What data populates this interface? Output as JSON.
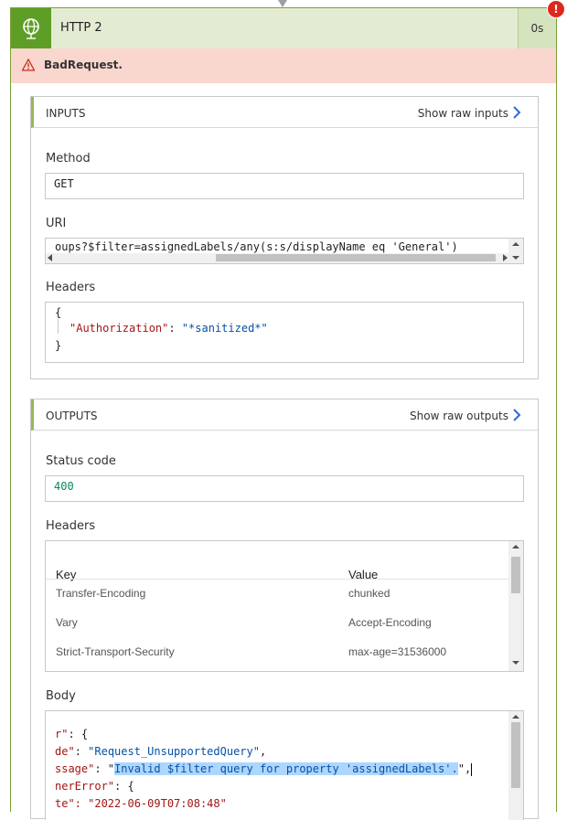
{
  "header": {
    "title": "HTTP 2",
    "duration": "0s",
    "error_badge": "!"
  },
  "error": {
    "message": "BadRequest."
  },
  "inputs": {
    "title": "INPUTS",
    "show_raw": "Show raw inputs",
    "method_label": "Method",
    "method_value": "GET",
    "uri_label": "URI",
    "uri_value": "oups?$filter=assignedLabels/any(s:s/displayName eq 'General')",
    "headers_label": "Headers",
    "headers_lines": {
      "open": "{",
      "key": "\"Authorization\"",
      "sep": ": ",
      "value": "\"*sanitized*\"",
      "close": "}"
    }
  },
  "outputs": {
    "title": "OUTPUTS",
    "show_raw": "Show raw outputs",
    "status_label": "Status code",
    "status_value": "400",
    "headers_label": "Headers",
    "table": {
      "col_key": "Key",
      "col_value": "Value",
      "rows": [
        {
          "key": "Transfer-Encoding",
          "value": "chunked"
        },
        {
          "key": "Vary",
          "value": "Accept-Encoding"
        },
        {
          "key": "Strict-Transport-Security",
          "value": "max-age=31536000"
        }
      ]
    },
    "body_label": "Body",
    "body_lines": {
      "l1_key": "r\"",
      "l1_rest": ": {",
      "l2_key": "de\"",
      "l2_sep": ": ",
      "l2_val": "\"Request_UnsupportedQuery\"",
      "l2_end": ",",
      "l3_key": "ssage\"",
      "l3_sep": ": \"",
      "l3_sel": "Invalid $filter query for property 'assignedLabels'.",
      "l3_end": "\",",
      "l4_key": "nerError\"",
      "l4_rest": ": {",
      "l5": "te\": \"2022-06-09T07:08:48\""
    }
  }
}
